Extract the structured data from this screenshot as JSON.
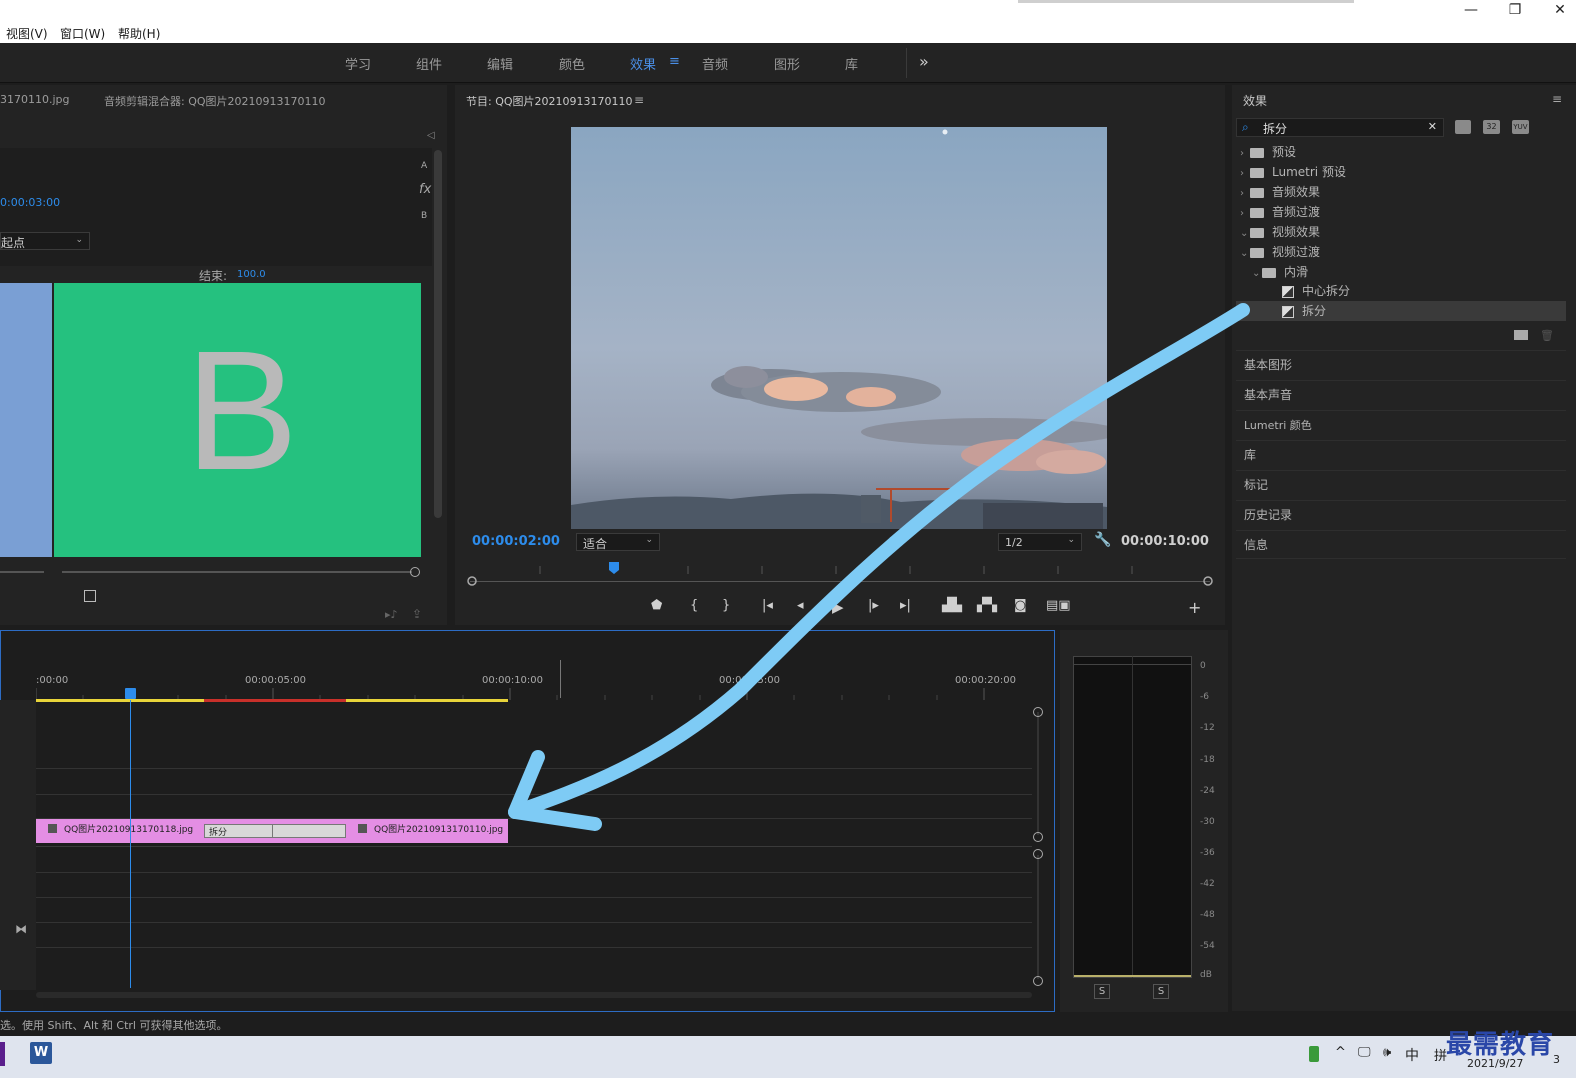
{
  "menu": {
    "view": "视图(V)",
    "window": "窗口(W)",
    "help": "帮助(H)"
  },
  "window_controls": {
    "minimize": "—",
    "restore": "❐",
    "close": "✕"
  },
  "workspaces": [
    "学习",
    "组件",
    "编辑",
    "颜色",
    "效果",
    "音频",
    "图形",
    "库"
  ],
  "workspace_active_index": 4,
  "workspace_more": "»",
  "effect_controls": {
    "tab_clip": "3170110.jpg",
    "tab_mixer": "音频剪辑混合器: QQ图片20210913170110",
    "duration": "0:00:03:00",
    "alignment": "起点",
    "end_label": "结束:",
    "end_value": "100.0",
    "a_label": "A",
    "fx_label": "fx",
    "b_label": "B",
    "preview_letter": "B",
    "collapse": "◁"
  },
  "program": {
    "title": "节目: QQ图片20210913170110",
    "current_time": "00:00:02:00",
    "fit": "适合",
    "resolution": "1/2",
    "duration": "00:00:10:00"
  },
  "effects_panel": {
    "title": "效果",
    "search_value": "拆分",
    "icons": [
      "32",
      "YUV"
    ],
    "tree": [
      {
        "label": "预设",
        "expanded": false,
        "level": 0
      },
      {
        "label": "Lumetri 预设",
        "expanded": false,
        "level": 0
      },
      {
        "label": "音频效果",
        "expanded": false,
        "level": 0
      },
      {
        "label": "音频过渡",
        "expanded": false,
        "level": 0
      },
      {
        "label": "视频效果",
        "expanded": true,
        "level": 0
      },
      {
        "label": "视频过渡",
        "expanded": true,
        "level": 0
      },
      {
        "label": "内滑",
        "expanded": true,
        "level": 1
      },
      {
        "label": "中心拆分",
        "level": 2,
        "item": true
      },
      {
        "label": "拆分",
        "level": 2,
        "item": true,
        "selected": true
      }
    ]
  },
  "panels": [
    "基本图形",
    "基本声音",
    "Lumetri 颜色",
    "库",
    "标记",
    "历史记录",
    "信息"
  ],
  "timeline": {
    "ticks": [
      ":00:00",
      "00:00:05:00",
      "00:00:10:00",
      "00:00:15:00",
      "00:00:20:00"
    ],
    "clip_a": "QQ图片20210913170118.jpg",
    "transition": "拆分",
    "clip_b": "QQ图片20210913170110.jpg"
  },
  "meter": {
    "db_labels": [
      "0",
      "-6",
      "-12",
      "-18",
      "-24",
      "-30",
      "-36",
      "-42",
      "-48",
      "-54",
      "dB"
    ],
    "solo": [
      "S",
      "S"
    ]
  },
  "status_bar": "选。使用 Shift、Alt 和 Ctrl 可获得其他选项。",
  "taskbar": {
    "word_icon": "W",
    "ime_1": "中",
    "ime_2": "拼",
    "date": "2021/9/27",
    "badge": "3"
  },
  "watermark": "最需教育",
  "colors": {
    "accent": "#2d8ceb",
    "clip": "#e48ee4",
    "transition_green": "#25c17f",
    "annotation": "#7ecbf5"
  }
}
